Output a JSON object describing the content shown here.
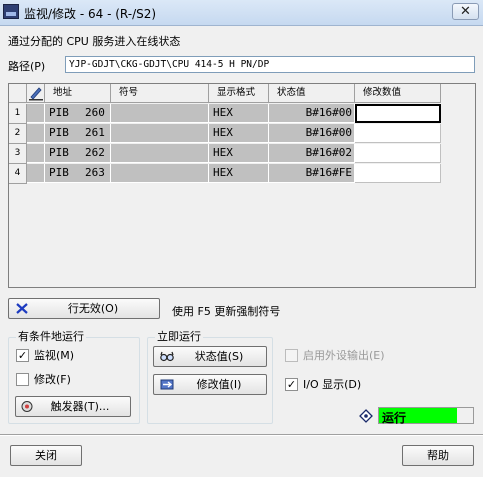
{
  "window": {
    "title": "监视/修改 - 64 - (R-/S2)",
    "close_glyph": "✕"
  },
  "info_text": "通过分配的 CPU 服务进入在线状态",
  "path": {
    "label": "路径(P)",
    "value": "YJP-GDJT\\CKG-GDJT\\CPU 414-5 H PN/DP"
  },
  "table": {
    "headers": {
      "address": "地址",
      "symbol": "符号",
      "format": "显示格式",
      "status_value": "状态值",
      "modify_value": "修改数值"
    },
    "rows": [
      {
        "num": "1",
        "op": "PIB",
        "addr": "260",
        "symbol": "",
        "format": "HEX",
        "status": "B#16#00",
        "modify": ""
      },
      {
        "num": "2",
        "op": "PIB",
        "addr": "261",
        "symbol": "",
        "format": "HEX",
        "status": "B#16#00",
        "modify": ""
      },
      {
        "num": "3",
        "op": "PIB",
        "addr": "262",
        "symbol": "",
        "format": "HEX",
        "status": "B#16#02",
        "modify": ""
      },
      {
        "num": "4",
        "op": "PIB",
        "addr": "263",
        "symbol": "",
        "format": "HEX",
        "status": "B#16#FE",
        "modify": ""
      }
    ]
  },
  "invalidate_button": {
    "label": "行无效(O)",
    "icon": "red-x-icon"
  },
  "hint_text": "使用 F5 更新强制符号",
  "conditional_run": {
    "title": "有条件地运行",
    "monitor": {
      "label": "监视(M)",
      "checked": true
    },
    "modify": {
      "label": "修改(F)",
      "checked": false
    },
    "trigger_button": {
      "label": "触发器(T)...",
      "icon": "trigger-icon"
    }
  },
  "immediate_run": {
    "title": "立即运行",
    "status_button": {
      "label": "状态值(S)",
      "icon": "glasses-icon"
    },
    "modify_button": {
      "label": "修改值(I)",
      "icon": "modify-icon"
    }
  },
  "options": {
    "enable_periphery": {
      "label": "启用外设输出(E)",
      "checked": false,
      "enabled": false
    },
    "io_display": {
      "label": "I/O 显示(D)",
      "checked": true,
      "enabled": true
    }
  },
  "run_status": {
    "label": "运行",
    "color": "#00ff00",
    "fill": 0.83,
    "icon": "diamond-indicator-icon"
  },
  "footer": {
    "close_label": "关闭",
    "help_label": "帮助"
  }
}
